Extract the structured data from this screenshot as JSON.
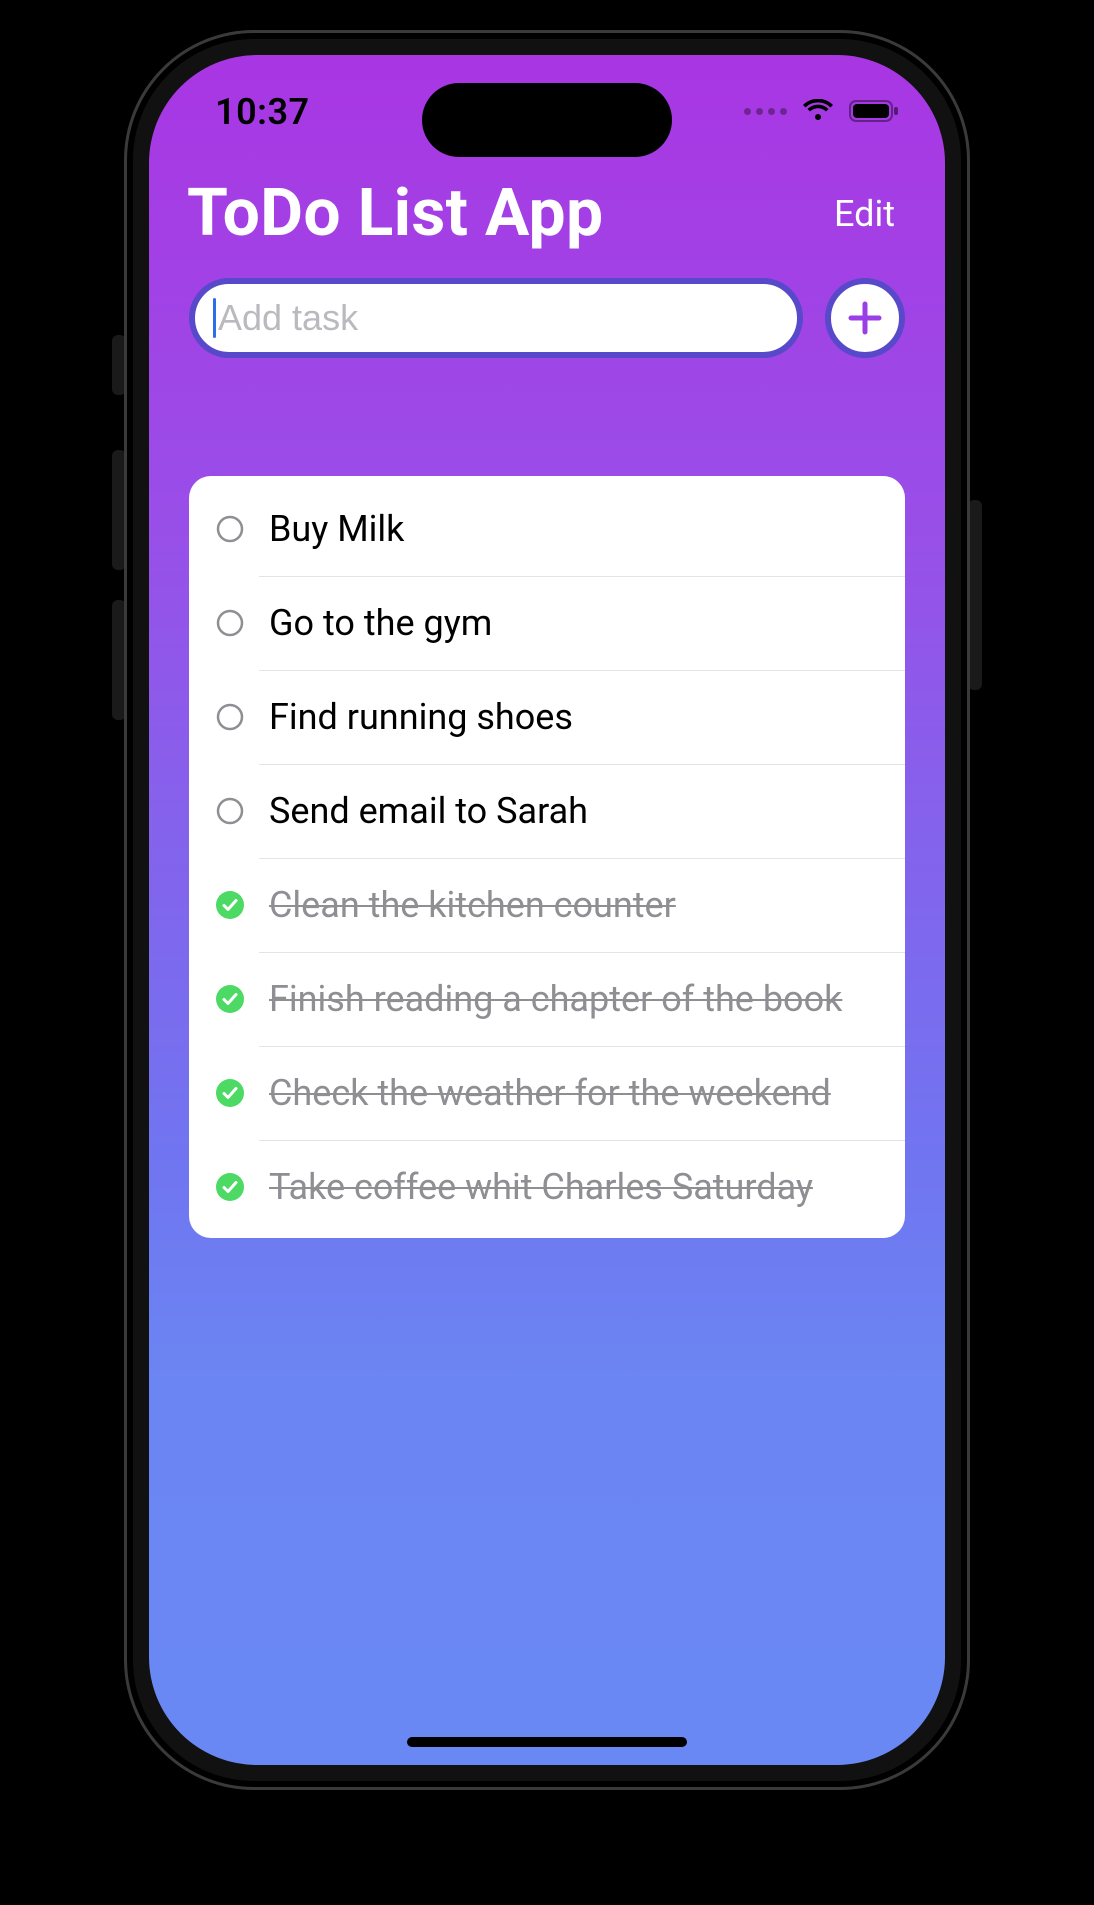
{
  "status_bar": {
    "time": "10:37"
  },
  "header": {
    "title": "ToDo List App",
    "edit_label": "Edit"
  },
  "add": {
    "placeholder": "Add task",
    "value": ""
  },
  "colors": {
    "accent_border": "#5749c9",
    "plus": "#9a3fe5",
    "done_green": "#4cd964"
  },
  "tasks": [
    {
      "text": "Buy Milk",
      "done": false
    },
    {
      "text": "Go to the gym",
      "done": false
    },
    {
      "text": "Find running shoes",
      "done": false
    },
    {
      "text": "Send email to Sarah",
      "done": false
    },
    {
      "text": "Clean the kitchen counter",
      "done": true
    },
    {
      "text": "Finish reading a chapter of the book",
      "done": true
    },
    {
      "text": "Check the weather for the weekend",
      "done": true
    },
    {
      "text": "Take coffee whit Charles Saturday",
      "done": true
    }
  ]
}
